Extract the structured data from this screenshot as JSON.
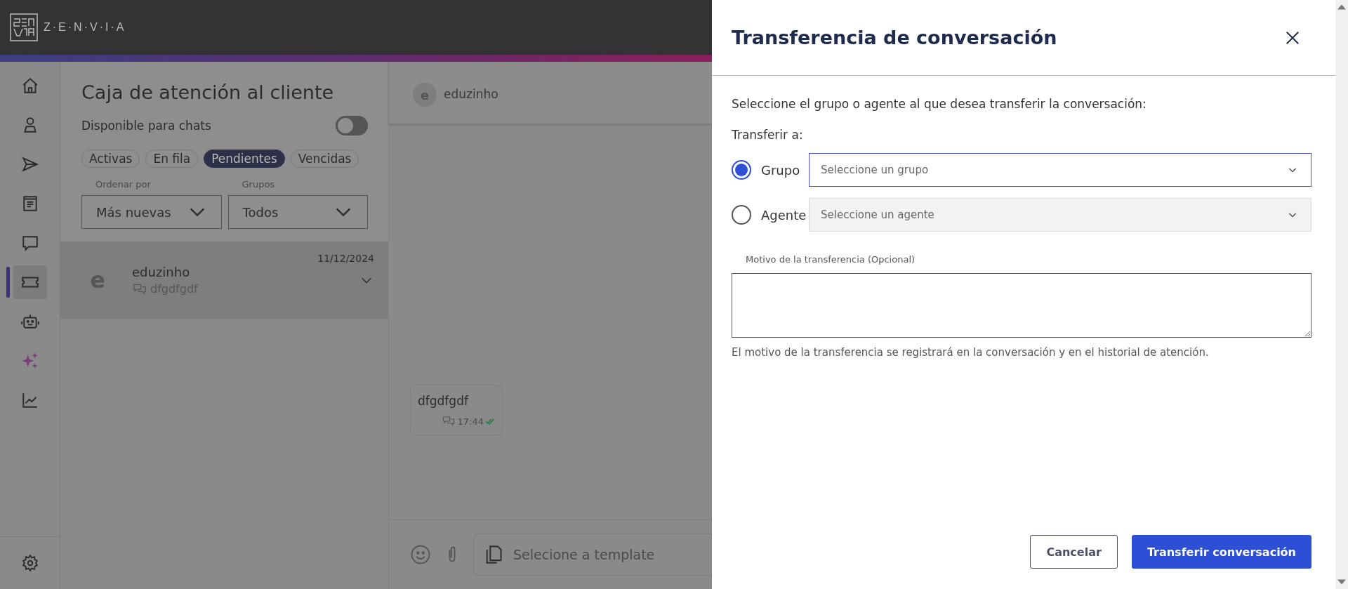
{
  "header": {
    "logo": "Z·E·N·V·I·A"
  },
  "nav": [
    {
      "kind": "home",
      "selected": false
    },
    {
      "kind": "person",
      "selected": false
    },
    {
      "kind": "send",
      "selected": false
    },
    {
      "kind": "document",
      "selected": false
    },
    {
      "kind": "chat",
      "selected": false
    },
    {
      "kind": "ticket",
      "selected": true
    },
    {
      "kind": "robot",
      "selected": false
    },
    {
      "kind": "sparkles",
      "selected": false
    },
    {
      "kind": "chart",
      "selected": false
    }
  ],
  "inbox": {
    "title": "Caja de atención al cliente",
    "availability": {
      "label": "Disponible para chats",
      "on": false
    },
    "filters": [
      {
        "label": "Activas",
        "selected": false
      },
      {
        "label": "En fila",
        "selected": false
      },
      {
        "label": "Pendientes",
        "selected": true
      },
      {
        "label": "Vencidas",
        "selected": false
      }
    ],
    "sort": {
      "label": "Ordenar por",
      "value": "Más nuevas"
    },
    "groups": {
      "label": "Grupos",
      "value": "Todos"
    },
    "conversations": [
      {
        "initial": "e",
        "name": "eduzinho",
        "preview": "dfgdfgdf",
        "date": "11/12/2024",
        "selected": true
      }
    ]
  },
  "chat": {
    "contact": {
      "initial": "e",
      "name": "eduzinho"
    },
    "messages": [
      {
        "text": "dfgdfgdf",
        "time": "17:44",
        "read": true
      }
    ],
    "composer": {
      "placeholder": "Selecione a template"
    }
  },
  "dialog": {
    "title": "Transferencia de conversación",
    "instruction": "Seleccione el grupo o agente al que desea transferir la conversación:",
    "target_label": "Transferir a:",
    "targets": [
      {
        "label": "Grupo",
        "placeholder": "Seleccione un grupo",
        "selected": true
      },
      {
        "label": "Agente",
        "placeholder": "Seleccione un agente",
        "selected": false
      }
    ],
    "reason": {
      "label": "Motivo de la transferencia (Opcional)",
      "hint": "El motivo de la transferencia se registrará en la conversación y en el historial de atención."
    },
    "buttons": [
      {
        "label": "Cancelar",
        "kind": "secondary"
      },
      {
        "label": "Transferir conversación",
        "kind": "primary"
      }
    ]
  }
}
